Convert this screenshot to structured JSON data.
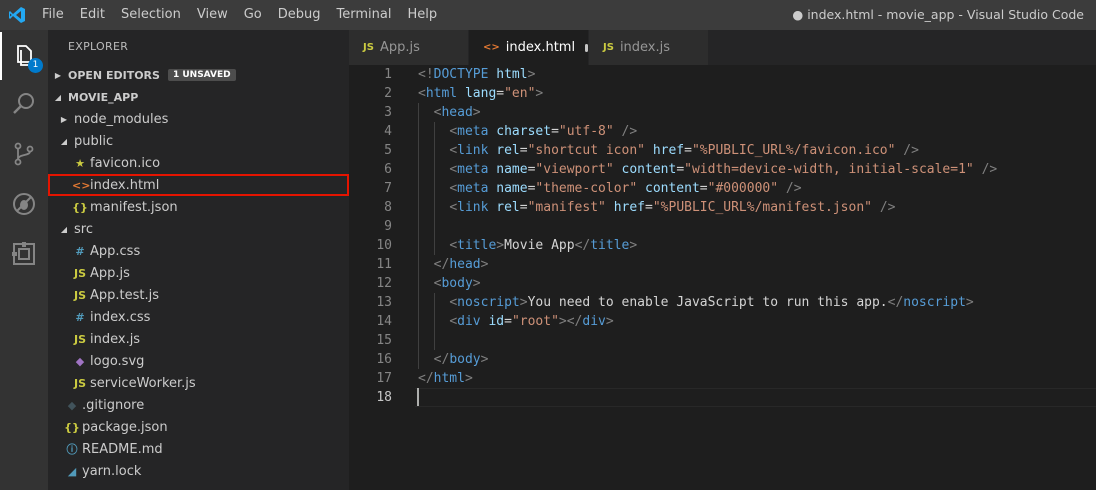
{
  "menu": [
    "File",
    "Edit",
    "Selection",
    "View",
    "Go",
    "Debug",
    "Terminal",
    "Help"
  ],
  "window_title": "● index.html - movie_app - Visual Studio Code",
  "activity": {
    "badge": "1"
  },
  "explorer": {
    "title": "EXPLORER",
    "open_editors": "OPEN EDITORS",
    "unsaved": "1 UNSAVED",
    "project": "MOVIE_APP",
    "items": [
      {
        "label": "node_modules",
        "kind": "folder",
        "collapsed": true,
        "depth": 1,
        "icon": "",
        "color": ""
      },
      {
        "label": "public",
        "kind": "folder",
        "collapsed": false,
        "depth": 1,
        "icon": "",
        "color": ""
      },
      {
        "label": "favicon.ico",
        "kind": "file",
        "depth": 2,
        "icon": "★",
        "color": "#cbcb41"
      },
      {
        "label": "index.html",
        "kind": "file",
        "depth": 2,
        "icon": "<>",
        "color": "#e37933",
        "selected": true
      },
      {
        "label": "manifest.json",
        "kind": "file",
        "depth": 2,
        "icon": "{}",
        "color": "#cbcb41"
      },
      {
        "label": "src",
        "kind": "folder",
        "collapsed": false,
        "depth": 1,
        "icon": "",
        "color": ""
      },
      {
        "label": "App.css",
        "kind": "file",
        "depth": 2,
        "icon": "#",
        "color": "#519aba"
      },
      {
        "label": "App.js",
        "kind": "file",
        "depth": 2,
        "icon": "JS",
        "color": "#cbcb41"
      },
      {
        "label": "App.test.js",
        "kind": "file",
        "depth": 2,
        "icon": "JS",
        "color": "#cbcb41"
      },
      {
        "label": "index.css",
        "kind": "file",
        "depth": 2,
        "icon": "#",
        "color": "#519aba"
      },
      {
        "label": "index.js",
        "kind": "file",
        "depth": 2,
        "icon": "JS",
        "color": "#cbcb41"
      },
      {
        "label": "logo.svg",
        "kind": "file",
        "depth": 2,
        "icon": "◆",
        "color": "#a074c4"
      },
      {
        "label": "serviceWorker.js",
        "kind": "file",
        "depth": 2,
        "icon": "JS",
        "color": "#cbcb41"
      },
      {
        "label": ".gitignore",
        "kind": "file",
        "depth": 1,
        "icon": "◆",
        "color": "#41535b"
      },
      {
        "label": "package.json",
        "kind": "file",
        "depth": 1,
        "icon": "{}",
        "color": "#cbcb41"
      },
      {
        "label": "README.md",
        "kind": "file",
        "depth": 1,
        "icon": "ⓘ",
        "color": "#519aba"
      },
      {
        "label": "yarn.lock",
        "kind": "file",
        "depth": 1,
        "icon": "◢",
        "color": "#519aba"
      }
    ]
  },
  "tabs": [
    {
      "label": "App.js",
      "icon": "JS",
      "color": "#cbcb41",
      "active": false,
      "dirty": false
    },
    {
      "label": "index.html",
      "icon": "<>",
      "color": "#e37933",
      "active": true,
      "dirty": true
    },
    {
      "label": "index.js",
      "icon": "JS",
      "color": "#cbcb41",
      "active": false,
      "dirty": false
    }
  ],
  "editor": {
    "current_line": 18,
    "lines": [
      [
        [
          "g",
          "<!"
        ],
        [
          "b",
          "DOCTYPE"
        ],
        [
          "t",
          " "
        ],
        [
          "a",
          "html"
        ],
        [
          "g",
          ">"
        ]
      ],
      [
        [
          "g",
          "<"
        ],
        [
          "b",
          "html"
        ],
        [
          "t",
          " "
        ],
        [
          "a",
          "lang"
        ],
        [
          "t",
          "="
        ],
        [
          "s",
          "\"en\""
        ],
        [
          "g",
          ">"
        ]
      ],
      [
        [
          "t",
          "  "
        ],
        [
          "g",
          "<"
        ],
        [
          "b",
          "head"
        ],
        [
          "g",
          ">"
        ]
      ],
      [
        [
          "t",
          "    "
        ],
        [
          "g",
          "<"
        ],
        [
          "b",
          "meta"
        ],
        [
          "t",
          " "
        ],
        [
          "a",
          "charset"
        ],
        [
          "t",
          "="
        ],
        [
          "s",
          "\"utf-8\""
        ],
        [
          "t",
          " "
        ],
        [
          "g",
          "/>"
        ]
      ],
      [
        [
          "t",
          "    "
        ],
        [
          "g",
          "<"
        ],
        [
          "b",
          "link"
        ],
        [
          "t",
          " "
        ],
        [
          "a",
          "rel"
        ],
        [
          "t",
          "="
        ],
        [
          "s",
          "\"shortcut icon\""
        ],
        [
          "t",
          " "
        ],
        [
          "a",
          "href"
        ],
        [
          "t",
          "="
        ],
        [
          "s",
          "\"%PUBLIC_URL%/favicon.ico\""
        ],
        [
          "t",
          " "
        ],
        [
          "g",
          "/>"
        ]
      ],
      [
        [
          "t",
          "    "
        ],
        [
          "g",
          "<"
        ],
        [
          "b",
          "meta"
        ],
        [
          "t",
          " "
        ],
        [
          "a",
          "name"
        ],
        [
          "t",
          "="
        ],
        [
          "s",
          "\"viewport\""
        ],
        [
          "t",
          " "
        ],
        [
          "a",
          "content"
        ],
        [
          "t",
          "="
        ],
        [
          "s",
          "\"width=device-width, initial-scale=1\""
        ],
        [
          "t",
          " "
        ],
        [
          "g",
          "/>"
        ]
      ],
      [
        [
          "t",
          "    "
        ],
        [
          "g",
          "<"
        ],
        [
          "b",
          "meta"
        ],
        [
          "t",
          " "
        ],
        [
          "a",
          "name"
        ],
        [
          "t",
          "="
        ],
        [
          "s",
          "\"theme-color\""
        ],
        [
          "t",
          " "
        ],
        [
          "a",
          "content"
        ],
        [
          "t",
          "="
        ],
        [
          "s",
          "\"#000000\""
        ],
        [
          "t",
          " "
        ],
        [
          "g",
          "/>"
        ]
      ],
      [
        [
          "t",
          "    "
        ],
        [
          "g",
          "<"
        ],
        [
          "b",
          "link"
        ],
        [
          "t",
          " "
        ],
        [
          "a",
          "rel"
        ],
        [
          "t",
          "="
        ],
        [
          "s",
          "\"manifest\""
        ],
        [
          "t",
          " "
        ],
        [
          "a",
          "href"
        ],
        [
          "t",
          "="
        ],
        [
          "s",
          "\"%PUBLIC_URL%/manifest.json\""
        ],
        [
          "t",
          " "
        ],
        [
          "g",
          "/>"
        ]
      ],
      [],
      [
        [
          "t",
          "    "
        ],
        [
          "g",
          "<"
        ],
        [
          "b",
          "title"
        ],
        [
          "g",
          ">"
        ],
        [
          "t",
          "Movie App"
        ],
        [
          "g",
          "</"
        ],
        [
          "b",
          "title"
        ],
        [
          "g",
          ">"
        ]
      ],
      [
        [
          "t",
          "  "
        ],
        [
          "g",
          "</"
        ],
        [
          "b",
          "head"
        ],
        [
          "g",
          ">"
        ]
      ],
      [
        [
          "t",
          "  "
        ],
        [
          "g",
          "<"
        ],
        [
          "b",
          "body"
        ],
        [
          "g",
          ">"
        ]
      ],
      [
        [
          "t",
          "    "
        ],
        [
          "g",
          "<"
        ],
        [
          "b",
          "noscript"
        ],
        [
          "g",
          ">"
        ],
        [
          "t",
          "You need to enable JavaScript to run this app."
        ],
        [
          "g",
          "</"
        ],
        [
          "b",
          "noscript"
        ],
        [
          "g",
          ">"
        ]
      ],
      [
        [
          "t",
          "    "
        ],
        [
          "g",
          "<"
        ],
        [
          "b",
          "div"
        ],
        [
          "t",
          " "
        ],
        [
          "a",
          "id"
        ],
        [
          "t",
          "="
        ],
        [
          "s",
          "\"root\""
        ],
        [
          "g",
          "></"
        ],
        [
          "b",
          "div"
        ],
        [
          "g",
          ">"
        ]
      ],
      [],
      [
        [
          "t",
          "  "
        ],
        [
          "g",
          "</"
        ],
        [
          "b",
          "body"
        ],
        [
          "g",
          ">"
        ]
      ],
      [
        [
          "g",
          "</"
        ],
        [
          "b",
          "html"
        ],
        [
          "g",
          ">"
        ]
      ],
      []
    ]
  }
}
